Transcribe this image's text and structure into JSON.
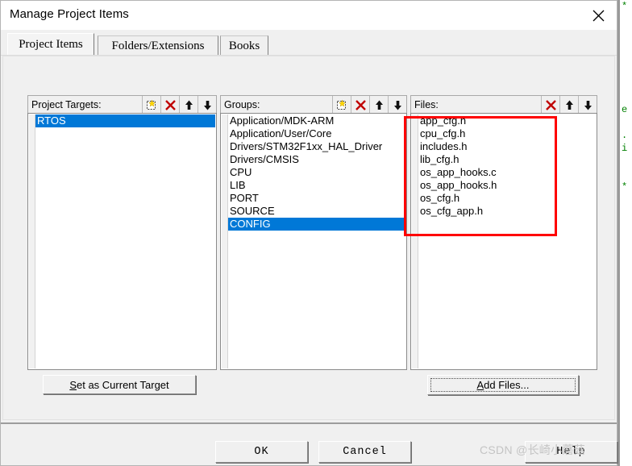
{
  "window": {
    "title": "Manage Project Items",
    "close_icon": "close-icon"
  },
  "tabs": [
    {
      "label": "Project Items",
      "selected": true
    },
    {
      "label": "Folders/Extensions",
      "selected": false
    },
    {
      "label": "Books",
      "selected": false
    }
  ],
  "panels": {
    "targets": {
      "header": "Project Targets:",
      "tools": [
        {
          "name": "new-item-icon",
          "title": "New (Insert)"
        },
        {
          "name": "delete-icon",
          "title": "Remove Item"
        },
        {
          "name": "move-up-icon",
          "title": "Move Up"
        },
        {
          "name": "move-down-icon",
          "title": "Move Down"
        }
      ],
      "items": [
        {
          "label": "RTOS",
          "selected": true
        }
      ]
    },
    "groups": {
      "header": "Groups:",
      "tools": [
        {
          "name": "new-item-icon",
          "title": "New (Insert)"
        },
        {
          "name": "delete-icon",
          "title": "Remove Item"
        },
        {
          "name": "move-up-icon",
          "title": "Move Up"
        },
        {
          "name": "move-down-icon",
          "title": "Move Down"
        }
      ],
      "items": [
        {
          "label": "Application/MDK-ARM",
          "selected": false
        },
        {
          "label": "Application/User/Core",
          "selected": false
        },
        {
          "label": "Drivers/STM32F1xx_HAL_Driver",
          "selected": false
        },
        {
          "label": "Drivers/CMSIS",
          "selected": false
        },
        {
          "label": "CPU",
          "selected": false
        },
        {
          "label": "LIB",
          "selected": false
        },
        {
          "label": "PORT",
          "selected": false
        },
        {
          "label": "SOURCE",
          "selected": false
        },
        {
          "label": "CONFIG",
          "selected": true
        }
      ]
    },
    "files": {
      "header": "Files:",
      "tools": [
        {
          "name": "delete-icon",
          "title": "Remove Item"
        },
        {
          "name": "move-up-icon",
          "title": "Move Up"
        },
        {
          "name": "move-down-icon",
          "title": "Move Down"
        }
      ],
      "items": [
        {
          "label": "app_cfg.h",
          "selected": false
        },
        {
          "label": "cpu_cfg.h",
          "selected": false
        },
        {
          "label": "includes.h",
          "selected": false
        },
        {
          "label": "lib_cfg.h",
          "selected": false
        },
        {
          "label": "os_app_hooks.c",
          "selected": false
        },
        {
          "label": "os_app_hooks.h",
          "selected": false
        },
        {
          "label": "os_cfg.h",
          "selected": false
        },
        {
          "label": "os_cfg_app.h",
          "selected": false
        }
      ]
    }
  },
  "buttons": {
    "set_as_current_target": "Set as Current Target",
    "add_files": "Add Files...",
    "ok": "OK",
    "cancel": "Cancel",
    "help": "Help"
  },
  "annotation": {
    "color": "#ff0000",
    "target": "files-listbox"
  },
  "watermark": {
    "text": "CSDN @长崎小蘑菇"
  },
  "background_editor": {
    "color": "#008000",
    "lines": [
      "*",
      "",
      "",
      "",
      "",
      "",
      "",
      "",
      "e",
      "",
      ".",
      "i",
      "",
      "",
      "*"
    ]
  },
  "colors": {
    "selection": "#0078d7",
    "dialog_face": "#f0f0f0",
    "list_background": "#ffffff",
    "annotation_red": "#ff0000",
    "comment_green": "#008000"
  }
}
